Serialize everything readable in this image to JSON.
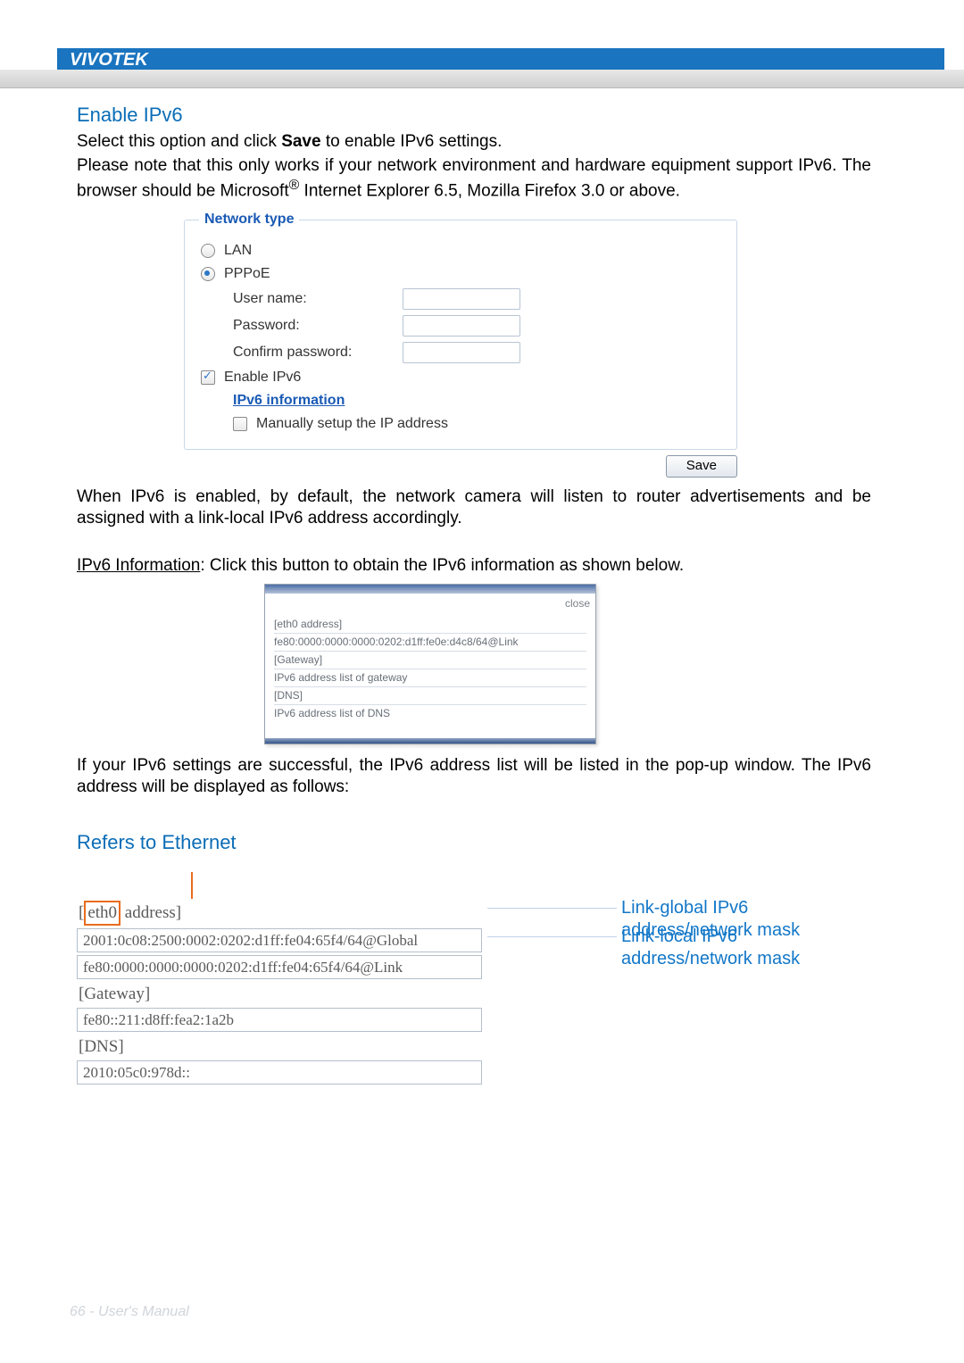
{
  "brand": "VIVOTEK",
  "h1": "Enable IPv6",
  "intro1_a": "Select this option and click ",
  "intro1_bold": "Save",
  "intro1_b": " to enable IPv6 settings.",
  "intro2": "Please note that this only works if your network environment and hardware equipment support IPv6. The browser should be Microsoft",
  "intro2_reg": "®",
  "intro2_tail": " Internet Explorer 6.5, Mozilla Firefox 3.0 or above.",
  "panel": {
    "legend": "Network type",
    "opt_lan": "LAN",
    "opt_pppoe": "PPPoE",
    "username": "User name:",
    "password": "Password:",
    "confirm": "Confirm password:",
    "enable_ipv6": "Enable IPv6",
    "ipv6_info": "IPv6 information",
    "manual": "Manually setup the IP address",
    "save": "Save"
  },
  "para_after_panel": "When IPv6 is enabled, by default, the network camera will listen to router advertisements and be assigned with a link-local IPv6 address accordingly.",
  "ipv6_info_label": "IPv6 Information",
  "ipv6_info_tail": ": Click this button to obtain the IPv6 information as shown below.",
  "popup": {
    "close": "close",
    "l1": "[eth0 address]",
    "l2": "fe80:0000:0000:0000:0202:d1ff:fe0e:d4c8/64@Link",
    "l3": "[Gateway]",
    "l4": "IPv6 address list of gateway",
    "l5": "[DNS]",
    "l6": "IPv6 address list of DNS"
  },
  "para_after_popup": "If your IPv6 settings are successful, the IPv6 address list will be listed in the pop-up window. The IPv6 address will be displayed as follows:",
  "refers": "Refers to Ethernet",
  "eth": {
    "hdr_box": "eth0",
    "hdr_tail": " address]",
    "addr_global": "2001:0c08:2500:0002:0202:d1ff:fe04:65f4/64@Global",
    "addr_link": "fe80:0000:0000:0000:0202:d1ff:fe04:65f4/64@Link",
    "gateway_hdr": "[Gateway]",
    "gateway_val": "fe80::211:d8ff:fea2:1a2b",
    "dns_hdr": "[DNS]",
    "dns_val": "2010:05c0:978d::"
  },
  "callouts": {
    "global": "Link-global IPv6 address/network mask",
    "local": "Link-local IPv6 address/network mask"
  },
  "footer": "66 - User's Manual"
}
